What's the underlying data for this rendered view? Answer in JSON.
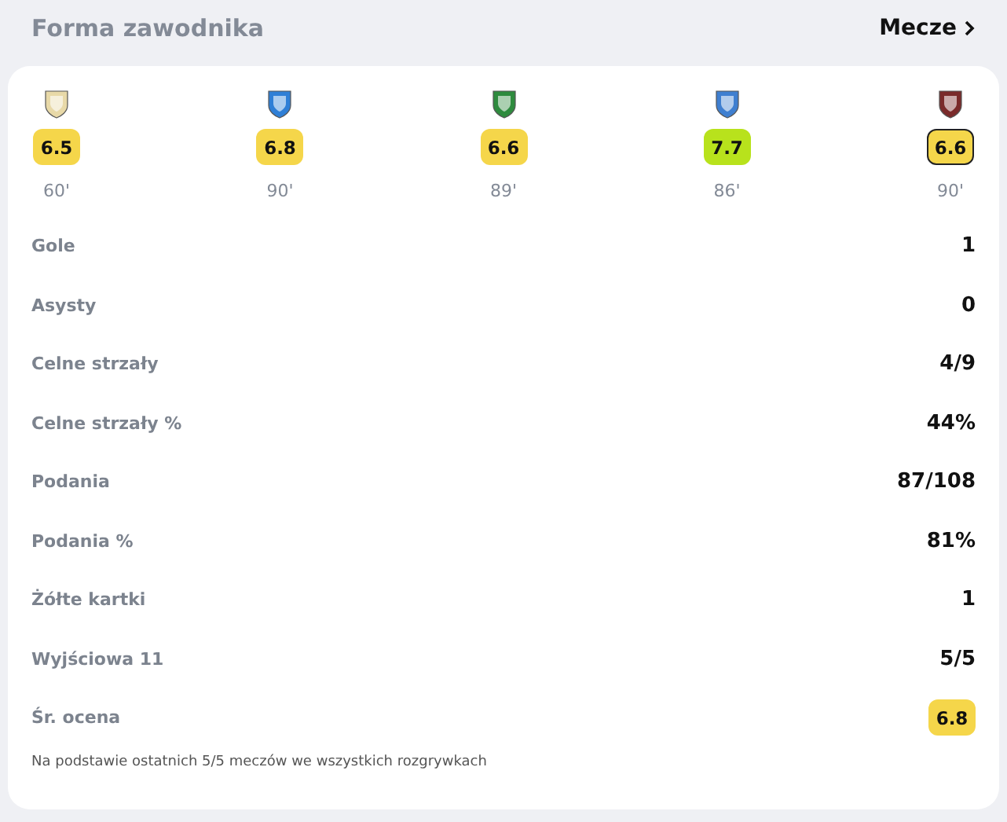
{
  "title": "Forma zawodnika",
  "matches_link": {
    "label": "Mecze"
  },
  "matches": [
    {
      "crest": {
        "color": "#e8d9a8"
      },
      "rating": "6.5",
      "color": "#f5d64a",
      "outlined": false,
      "minutes": "60'"
    },
    {
      "crest": {
        "color": "#2f7fd6"
      },
      "rating": "6.8",
      "color": "#f5d64a",
      "outlined": false,
      "minutes": "90'"
    },
    {
      "crest": {
        "color": "#2e8b3e"
      },
      "rating": "6.6",
      "color": "#f5d64a",
      "outlined": false,
      "minutes": "89'"
    },
    {
      "crest": {
        "color": "#3f7fd0"
      },
      "rating": "7.7",
      "color": "#b8e21c",
      "outlined": false,
      "minutes": "86'"
    },
    {
      "crest": {
        "color": "#7a2a2a"
      },
      "rating": "6.6",
      "color": "#f5d64a",
      "outlined": true,
      "minutes": "90'"
    }
  ],
  "stats": [
    {
      "label": "Gole",
      "value": "1",
      "kind": "text"
    },
    {
      "label": "Asysty",
      "value": "0",
      "kind": "text"
    },
    {
      "label": "Celne strzały",
      "value": "4/9",
      "kind": "text"
    },
    {
      "label": "Celne strzały %",
      "value": "44%",
      "kind": "text"
    },
    {
      "label": "Podania",
      "value": "87/108",
      "kind": "text"
    },
    {
      "label": "Podania %",
      "value": "81%",
      "kind": "text"
    },
    {
      "label": "Żółte kartki",
      "value": "1",
      "kind": "text"
    },
    {
      "label": "Wyjściowa 11",
      "value": "5/5",
      "kind": "text"
    },
    {
      "label": "Śr. ocena",
      "value": "6.8",
      "kind": "rating",
      "color": "#f5d64a"
    }
  ],
  "footnote": "Na podstawie ostatnich 5/5 meczów we wszystkich rozgrywkach"
}
